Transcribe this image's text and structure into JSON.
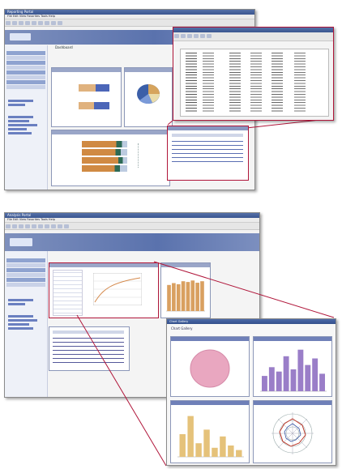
{
  "top_browser": {
    "title": "Reporting Portal",
    "menu": "File  Edit  View  Favorites  Tools  Help",
    "dashboard_label": "Dashboard",
    "spreadsheet_rows": 22,
    "table_rows": 6
  },
  "bottom_browser": {
    "title": "Analysis Portal",
    "menu": "File  Edit  View  Favorites  Tools  Help",
    "table_rows": 7
  },
  "popup": {
    "title": "Chart Gallery",
    "heading": "Chart Gallery",
    "purple_bars": [
      0.35,
      0.55,
      0.45,
      0.8,
      0.5,
      0.95,
      0.6,
      0.75,
      0.4
    ],
    "yellow_bars": [
      0.5,
      0.9,
      0.3,
      0.6,
      0.2,
      0.45,
      0.25,
      0.15
    ],
    "orange_bars": [
      0.7,
      0.75,
      0.72,
      0.8,
      0.78,
      0.82,
      0.76,
      0.8
    ]
  },
  "colors": {
    "frame": "#b0163a",
    "banner": "#5a72ad",
    "purple": "#9a7ec8",
    "yellow": "#e5c27a",
    "orange": "#d9a060",
    "pink": "#e9a7c0"
  }
}
